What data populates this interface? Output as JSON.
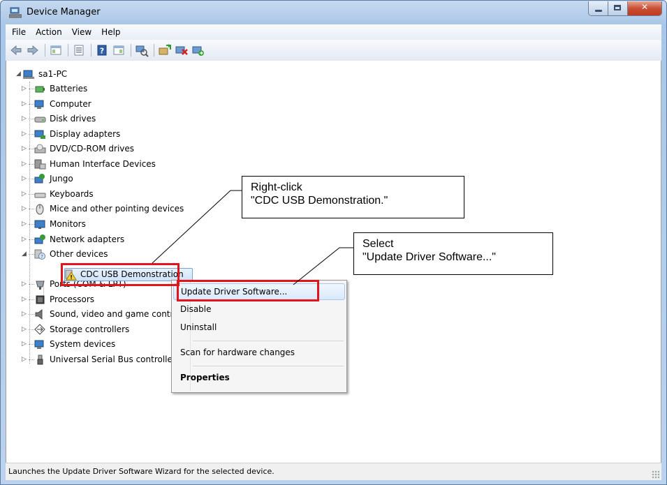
{
  "window": {
    "title": "Device Manager"
  },
  "menubar": [
    "File",
    "Action",
    "View",
    "Help"
  ],
  "toolbar": [
    "back-icon",
    "forward-icon",
    "show-hide-console-tree-icon",
    "properties-icon",
    "help-icon",
    "action-pane-icon",
    "scan-hardware-icon",
    "update-driver-icon",
    "uninstall-icon",
    "enable-device-icon"
  ],
  "tree": {
    "root": "sa1-PC",
    "categories": [
      {
        "label": "Batteries",
        "icon": "battery-icon"
      },
      {
        "label": "Computer",
        "icon": "computer-icon"
      },
      {
        "label": "Disk drives",
        "icon": "disk-drive-icon"
      },
      {
        "label": "Display adapters",
        "icon": "display-adapter-icon"
      },
      {
        "label": "DVD/CD-ROM drives",
        "icon": "dvd-drive-icon"
      },
      {
        "label": "Human Interface Devices",
        "icon": "hid-icon"
      },
      {
        "label": "Jungo",
        "icon": "jungo-icon"
      },
      {
        "label": "Keyboards",
        "icon": "keyboard-icon"
      },
      {
        "label": "Mice and other pointing devices",
        "icon": "mouse-icon"
      },
      {
        "label": "Monitors",
        "icon": "monitor-icon"
      },
      {
        "label": "Network adapters",
        "icon": "network-adapter-icon"
      },
      {
        "label": "Other devices",
        "icon": "unknown-device-icon"
      },
      {
        "label": "Ports (COM & LPT)",
        "icon": "port-icon"
      },
      {
        "label": "Processors",
        "icon": "processor-icon"
      },
      {
        "label": "Sound, video and game controllers",
        "icon": "sound-icon"
      },
      {
        "label": "Storage controllers",
        "icon": "storage-icon"
      },
      {
        "label": "System devices",
        "icon": "system-device-icon"
      },
      {
        "label": "Universal Serial Bus controllers",
        "icon": "usb-icon"
      }
    ],
    "other_device_child": "CDC USB Demonstration"
  },
  "context_menu": {
    "items": [
      "Update Driver Software...",
      "Disable",
      "Uninstall",
      "Scan for hardware changes",
      "Properties"
    ]
  },
  "callouts": {
    "right_click": {
      "line1": "Right-click",
      "line2": "\"CDC USB Demonstration.\""
    },
    "select": {
      "line1": "Select",
      "line2": "\"Update Driver Software...\""
    }
  },
  "statusbar": {
    "text": "Launches the Update Driver Software Wizard for the selected device."
  },
  "colors": {
    "highlight_border": "#e3141c",
    "title_gradient": "#a9c6e6",
    "selection": "#cfe3fb"
  }
}
